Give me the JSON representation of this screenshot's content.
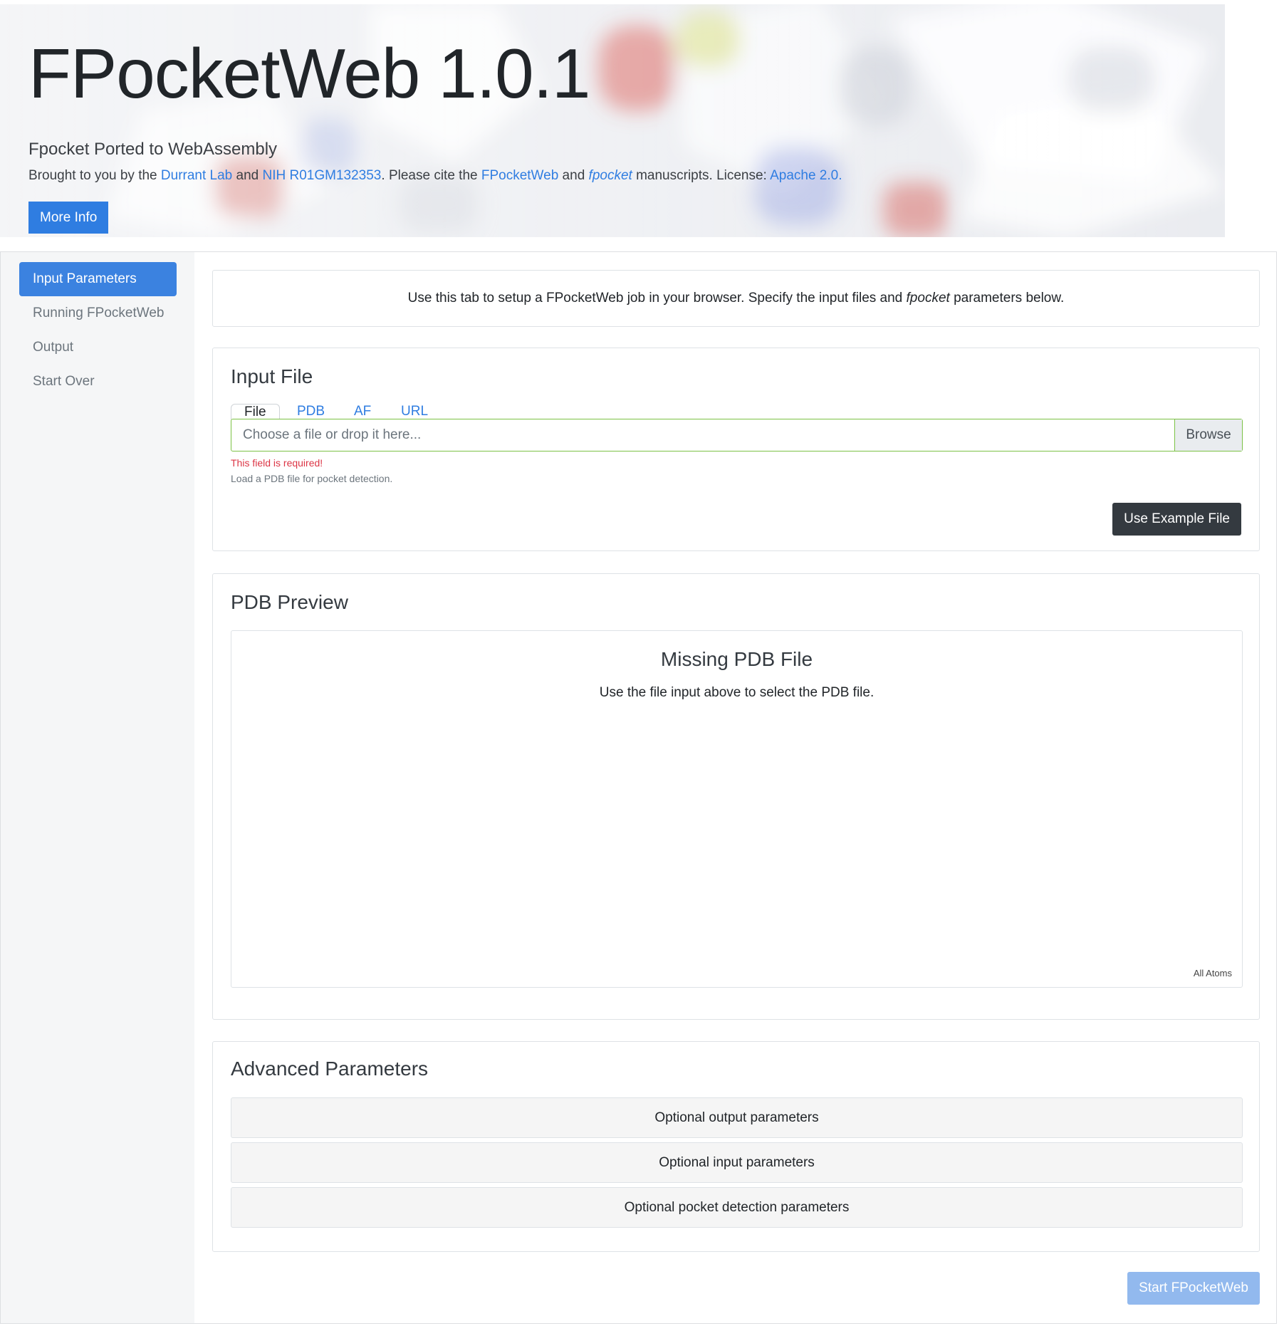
{
  "header": {
    "title": "FPocketWeb 1.0.1",
    "lead": "Fpocket Ported to WebAssembly",
    "credits": {
      "t1": "Brought to you by the ",
      "link_durrant": "Durrant Lab",
      "t2": " and ",
      "link_nih": "NIH R01GM132353",
      "t3": ". Please cite the ",
      "link_fpocketweb": "FPocketWeb",
      "t4": " and ",
      "link_fpocket": "fpocket",
      "t5": " manuscripts. License: ",
      "link_license": "Apache 2.0."
    },
    "more_info_label": "More Info"
  },
  "sidebar": {
    "items": [
      {
        "label": "Input Parameters",
        "active": true
      },
      {
        "label": "Running FPocketWeb",
        "active": false
      },
      {
        "label": "Output",
        "active": false
      },
      {
        "label": "Start Over",
        "active": false
      }
    ]
  },
  "intro": {
    "text_before": "Use this tab to setup a FPocketWeb job in your browser. Specify the input files and ",
    "text_em": "fpocket",
    "text_after": " parameters below."
  },
  "input_file": {
    "title": "Input File",
    "tabs": [
      {
        "label": "File",
        "active": true
      },
      {
        "label": "PDB",
        "active": false
      },
      {
        "label": "AF",
        "active": false
      },
      {
        "label": "URL",
        "active": false
      }
    ],
    "placeholder": "Choose a file or drop it here...",
    "browse_label": "Browse",
    "error": "This field is required!",
    "help": "Load a PDB file for pocket detection.",
    "example_button": "Use Example File"
  },
  "pdb_preview": {
    "title": "PDB Preview",
    "missing_title": "Missing PDB File",
    "missing_sub": "Use the file input above to select the PDB file.",
    "mode": "All Atoms"
  },
  "advanced": {
    "title": "Advanced Parameters",
    "items": [
      "Optional output parameters",
      "Optional input parameters",
      "Optional pocket detection parameters"
    ]
  },
  "start_button": "Start FPocketWeb",
  "colors": {
    "primary": "#2f7de1",
    "dark_button": "#343a40",
    "error": "#dc3545",
    "valid_border": "#7cc245"
  }
}
